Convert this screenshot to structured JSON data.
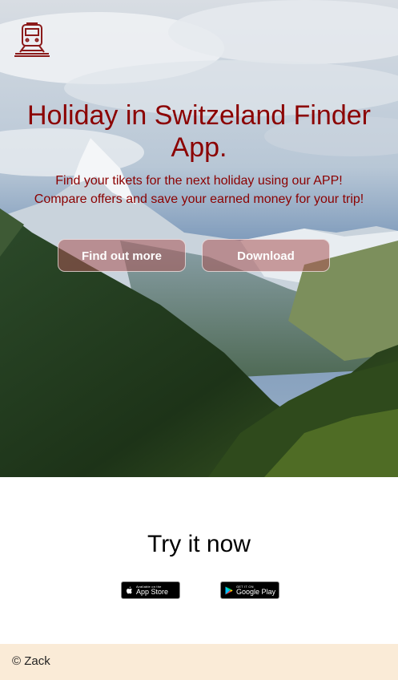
{
  "hero": {
    "logo_icon": "train-icon",
    "title": "Holiday in Switzeland Finder App.",
    "subtitle_lines": [
      "Find your tikets for the next holiday using our APP!",
      "Compare offers and save your earned money for your trip!"
    ],
    "buttons": {
      "find_out_more": "Find out more",
      "download": "Download"
    }
  },
  "try_now": {
    "heading": "Try it now",
    "app_store": {
      "small": "Available on the",
      "big": "App Store",
      "icon": "apple-icon"
    },
    "google_play": {
      "small": "GET IT ON",
      "big": "Google Play",
      "icon": "google-play-icon"
    }
  },
  "footer": {
    "text": "© Zack"
  },
  "colors": {
    "accent": "#8b0000",
    "footer_bg": "#faebd7"
  }
}
